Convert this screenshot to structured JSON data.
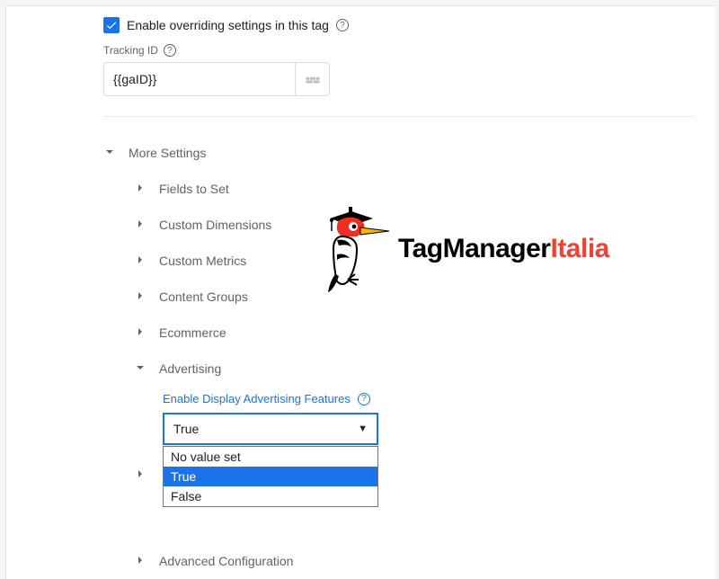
{
  "override": {
    "checked": true,
    "label": "Enable overriding settings in this tag"
  },
  "tracking_id": {
    "label": "Tracking ID",
    "value": "{{gaID}}"
  },
  "tree": {
    "more_settings": "More Settings",
    "items": [
      "Fields to Set",
      "Custom Dimensions",
      "Custom Metrics",
      "Content Groups",
      "Ecommerce"
    ],
    "advertising": {
      "label": "Advertising",
      "field_label": "Enable Display Advertising Features",
      "select": {
        "value": "True",
        "options": [
          "No value set",
          "True",
          "False"
        ],
        "selected_index": 1
      }
    },
    "advanced_config": "Advanced Configuration"
  },
  "logo": {
    "brand_a": "TagManager",
    "brand_b": "Italia"
  }
}
